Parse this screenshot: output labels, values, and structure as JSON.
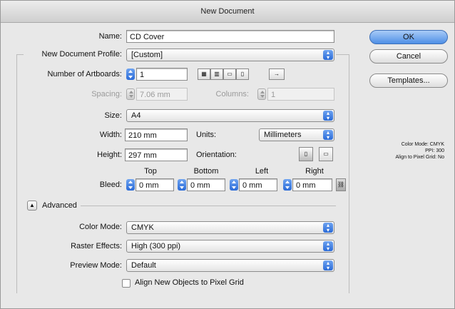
{
  "window": {
    "title": "New Document"
  },
  "name": {
    "label": "Name:",
    "value": "CD Cover"
  },
  "profile": {
    "label": "New Document Profile:",
    "value": "[Custom]"
  },
  "artboards": {
    "label": "Number of Artboards:",
    "value": "1",
    "spacing_label": "Spacing:",
    "spacing_value": "7.06 mm",
    "columns_label": "Columns:",
    "columns_value": "1",
    "layout_icons": [
      "grid-by-row-icon",
      "grid-by-column-icon",
      "arrange-by-row-icon",
      "arrange-by-column-icon",
      "right-to-left-icon"
    ]
  },
  "size": {
    "label": "Size:",
    "value": "A4"
  },
  "width": {
    "label": "Width:",
    "value": "210 mm"
  },
  "units": {
    "label": "Units:",
    "value": "Millimeters"
  },
  "height": {
    "label": "Height:",
    "value": "297 mm"
  },
  "orientation": {
    "label": "Orientation:"
  },
  "bleed": {
    "label": "Bleed:",
    "top_label": "Top",
    "top_value": "0 mm",
    "bottom_label": "Bottom",
    "bottom_value": "0 mm",
    "left_label": "Left",
    "left_value": "0 mm",
    "right_label": "Right",
    "right_value": "0 mm"
  },
  "advanced": {
    "label": "Advanced",
    "color_mode_label": "Color Mode:",
    "color_mode_value": "CMYK",
    "raster_label": "Raster Effects:",
    "raster_value": "High (300 ppi)",
    "preview_label": "Preview Mode:",
    "preview_value": "Default",
    "align_label": "Align New Objects to Pixel Grid"
  },
  "buttons": {
    "ok": "OK",
    "cancel": "Cancel",
    "templates": "Templates..."
  },
  "summary": {
    "line1": "Color Mode: CMYK",
    "line2": "PPI: 300",
    "line3": "Align to Pixel Grid: No"
  },
  "colors": {
    "accent": "#2b6bd8",
    "default_button": "#4f8fe6"
  }
}
